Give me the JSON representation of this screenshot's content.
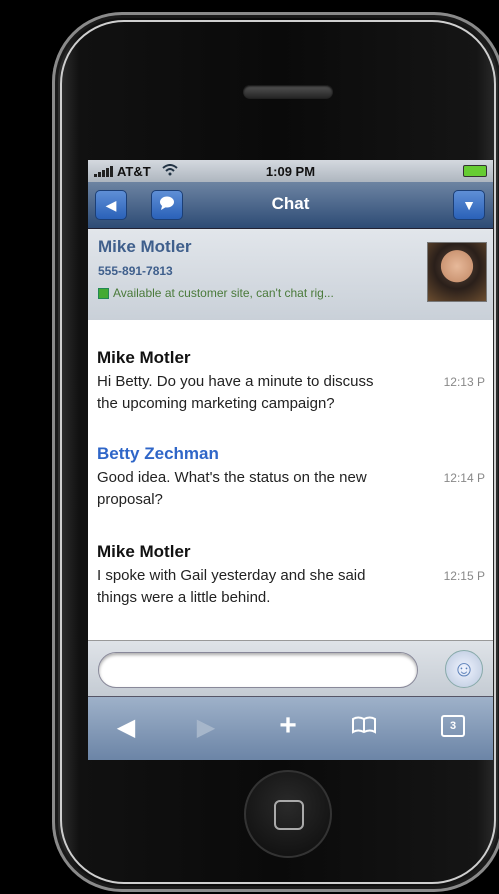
{
  "status_bar": {
    "carrier": "AT&T",
    "time": "1:09 PM"
  },
  "nav": {
    "title": "Chat"
  },
  "contact": {
    "name": "Mike Motler",
    "phone": "555-891-7813",
    "status": "Available at customer site, can't chat rig..."
  },
  "messages": [
    {
      "sender": "Mike Motler",
      "text": "Hi Betty. Do you have a minute to discuss the upcoming marketing campaign?",
      "time": "12:13 P"
    },
    {
      "sender": "Betty Zechman",
      "text": "Good idea. What's the status on the new proposal?",
      "time": "12:14 P"
    },
    {
      "sender": "Mike Motler",
      "text": "I spoke with Gail yesterday and she said things were a little behind.",
      "time": "12:15 P"
    }
  ],
  "composer": {
    "placeholder": ""
  },
  "toolbar": {
    "tabs_count": "3"
  },
  "colors": {
    "self_sender": "#2f66c8",
    "nav": "#2d4b75",
    "status_online": "#44aa33"
  }
}
